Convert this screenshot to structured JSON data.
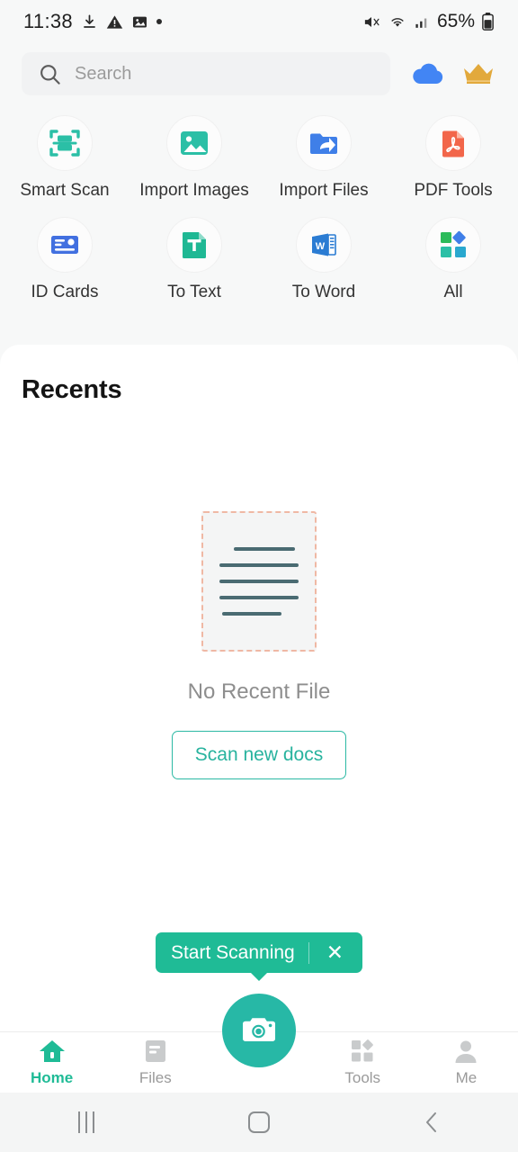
{
  "status_bar": {
    "time": "11:38",
    "icons_left": [
      "download-complete-icon",
      "warning-triangle-icon",
      "image-icon",
      "dot-icon"
    ],
    "icons_right": [
      "mute-icon",
      "wifi-icon",
      "signal-icon"
    ],
    "battery_text": "65%"
  },
  "search": {
    "placeholder": "Search",
    "icon": "search-icon",
    "cloud_icon": "cloud-icon",
    "premium_icon": "crown-icon",
    "cloud_color": "#4285f4",
    "crown_color": "#e2a93c"
  },
  "shortcuts": [
    {
      "label": "Smart Scan",
      "icon": "smart-scan-icon",
      "color": "#2bbfa6"
    },
    {
      "label": "Import Images",
      "icon": "import-images-icon",
      "color": "#2bbfa6"
    },
    {
      "label": "Import Files",
      "icon": "import-files-icon",
      "color": "#3f7fe8"
    },
    {
      "label": "PDF Tools",
      "icon": "pdf-tools-icon",
      "color": "#f2664a"
    },
    {
      "label": "ID Cards",
      "icon": "id-cards-icon",
      "color": "#4270e0"
    },
    {
      "label": "To Text",
      "icon": "to-text-icon",
      "color": "#1fb894"
    },
    {
      "label": "To Word",
      "icon": "to-word-icon",
      "color": "#2b7cd3"
    },
    {
      "label": "All",
      "icon": "all-tools-icon",
      "color": "#2bbb5a"
    }
  ],
  "recents": {
    "title": "Recents",
    "empty_text": "No Recent File",
    "scan_button": "Scan new docs",
    "illustration_icon": "empty-document-icon",
    "accent_color": "#28b39e"
  },
  "tooltip": {
    "text": "Start Scanning",
    "close_icon": "close-icon",
    "background": "#1fbb96"
  },
  "bottom_nav": {
    "items": [
      {
        "label": "Home",
        "icon": "home-icon",
        "active": true
      },
      {
        "label": "Files",
        "icon": "files-icon",
        "active": false
      },
      {
        "label": "Tools",
        "icon": "tools-icon",
        "active": false
      },
      {
        "label": "Me",
        "icon": "person-icon",
        "active": false
      }
    ],
    "camera_button_icon": "camera-icon",
    "active_color": "#1fbb96"
  },
  "android_nav": {
    "recents_icon": "recent-apps-icon",
    "home_icon": "home-square-icon",
    "back_icon": "back-chevron-icon"
  }
}
